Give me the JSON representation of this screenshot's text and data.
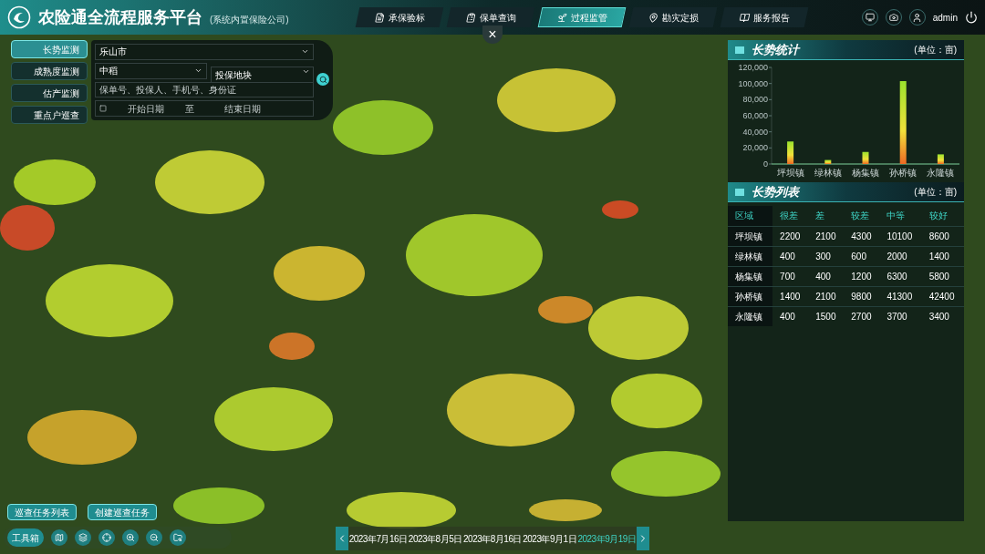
{
  "header": {
    "title": "农险通全流程服务平台",
    "subtitle": "(系统内置保险公司)",
    "user": "admin"
  },
  "nav": [
    {
      "label": "承保验标",
      "selected": false
    },
    {
      "label": "保单查询",
      "selected": false
    },
    {
      "label": "过程监管",
      "selected": true
    },
    {
      "label": "勘灾定损",
      "selected": false
    },
    {
      "label": "服务报告",
      "selected": false
    }
  ],
  "close_button": "×",
  "side_tabs": [
    {
      "label": "长势监测",
      "selected": true
    },
    {
      "label": "成熟度监测",
      "selected": false
    },
    {
      "label": "估产监测",
      "selected": false
    },
    {
      "label": "重点户巡查",
      "selected": false
    }
  ],
  "filter": {
    "city": "乐山市",
    "crop": "中稻",
    "plot": {
      "placeholder": "投保地块"
    },
    "search": {
      "placeholder": "保单号、投保人、手机号、身份证"
    },
    "checked": false,
    "start": {
      "placeholder": "开始日期"
    },
    "separator": "至",
    "end": {
      "placeholder": "结束日期"
    }
  },
  "stats": {
    "title": "长势统计",
    "unit": "(单位：亩)",
    "chart_data": {
      "type": "bar",
      "categories": [
        "坪坝镇",
        "绿林镇",
        "杨集镇",
        "孙桥镇",
        "永隆镇"
      ],
      "series": [
        {
          "color": "#9be22d",
          "values": [
            28000,
            5000,
            15000,
            103000,
            12000
          ]
        }
      ],
      "ylim": [
        0,
        120000
      ],
      "yticks": [
        {
          "value": 0,
          "label": "0"
        },
        {
          "value": 20000,
          "label": "20,000"
        },
        {
          "value": 40000,
          "label": "40,000"
        },
        {
          "value": 60000,
          "label": "60,000"
        },
        {
          "value": 80000,
          "label": "80,000"
        },
        {
          "value": 100000,
          "label": "100,000"
        },
        {
          "value": 120000,
          "label": "120,000"
        }
      ]
    }
  },
  "growth_table": {
    "title": "长势列表",
    "unit": "(单位：亩)",
    "columns": [
      "区域",
      "很差",
      "差",
      "较差",
      "中等",
      "较好"
    ],
    "rows": [
      [
        "坪坝镇",
        "2200",
        "2100",
        "4300",
        "10100",
        "8600"
      ],
      [
        "绿林镇",
        "400",
        "300",
        "600",
        "2000",
        "1400"
      ],
      [
        "杨集镇",
        "700",
        "400",
        "1200",
        "6300",
        "5800"
      ],
      [
        "孙桥镇",
        "1400",
        "2100",
        "9800",
        "41300",
        "42400"
      ],
      [
        "永隆镇",
        "400",
        "1500",
        "2700",
        "3700",
        "3400"
      ]
    ]
  },
  "task_buttons": [
    "巡查任务列表",
    "创建巡查任务"
  ],
  "toolbox": "工具箱",
  "timeline": [
    {
      "label": "2023年7月16日",
      "selected": false
    },
    {
      "label": "2023年8月5日",
      "selected": false
    },
    {
      "label": "2023年8月16日",
      "selected": false
    },
    {
      "label": "2023年9月1日",
      "selected": false
    },
    {
      "label": "2023年9月19日",
      "selected": true
    }
  ]
}
